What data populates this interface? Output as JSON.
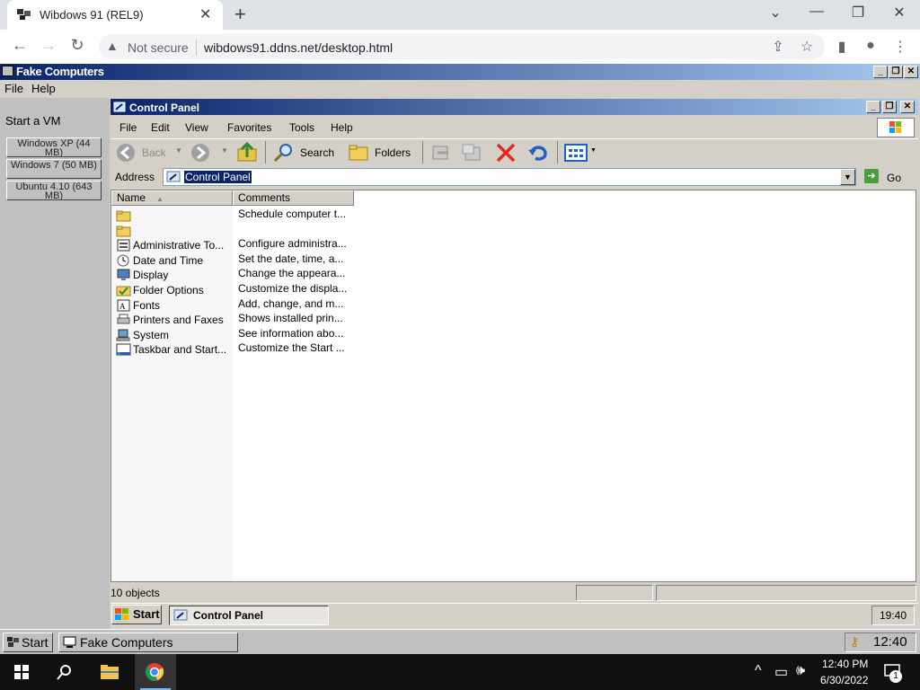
{
  "browser": {
    "tab_title": "Wibdows 91 (REL9)",
    "tab_close": "✕",
    "new_tab": "+",
    "security_label": "Not secure",
    "url": "wibdows91.ddns.net/desktop.html"
  },
  "outer_window": {
    "title": "Fake Computers",
    "menu": [
      "File",
      "Help"
    ],
    "sidebar_heading": "Start a VM",
    "vm_buttons": [
      "Windows XP (44 MB)",
      "Windows 7 (50 MB)",
      "Ubuntu 4.10 (643 MB)"
    ]
  },
  "control_panel": {
    "title": "Control Panel",
    "menu": [
      "File",
      "Edit",
      "View",
      "Favorites",
      "Tools",
      "Help"
    ],
    "toolbar": {
      "back": "Back",
      "search": "Search",
      "folders": "Folders"
    },
    "address_label": "Address",
    "address_value": "Control Panel",
    "go_label": "Go",
    "columns": [
      "Name",
      "Comments"
    ],
    "rows": [
      {
        "name": "",
        "comment": "Schedule computer t...",
        "icon": "folder-icon"
      },
      {
        "name": "",
        "comment": "",
        "icon": "folder-icon"
      },
      {
        "name": "Administrative To...",
        "comment": "Configure administra...",
        "icon": "admin-tools-icon"
      },
      {
        "name": "Date and Time",
        "comment": "Set the date, time, a...",
        "icon": "date-time-icon"
      },
      {
        "name": "Display",
        "comment": "Change the appeara...",
        "icon": "display-icon"
      },
      {
        "name": "Folder Options",
        "comment": "Customize the displa...",
        "icon": "folder-options-icon"
      },
      {
        "name": "Fonts",
        "comment": "Add, change, and m...",
        "icon": "fonts-icon"
      },
      {
        "name": "Printers and Faxes",
        "comment": "Shows installed prin...",
        "icon": "printers-icon"
      },
      {
        "name": "System",
        "comment": "See information abo...",
        "icon": "system-icon"
      },
      {
        "name": "Taskbar and Start...",
        "comment": "Customize the Start ...",
        "icon": "taskbar-icon"
      }
    ],
    "status": "10 objects"
  },
  "inner_taskbar": {
    "start": "Start",
    "task": "Control Panel",
    "clock": "19:40"
  },
  "outer_taskbar": {
    "start": "Start",
    "task": "Fake Computers",
    "clock": "12:40"
  },
  "windows10": {
    "time": "12:40 PM",
    "date": "6/30/2022",
    "notification_count": "1"
  },
  "colors": {
    "titlebar_start": "#0a246a",
    "titlebar_end": "#a6caf0",
    "face": "#d4d0c8"
  }
}
